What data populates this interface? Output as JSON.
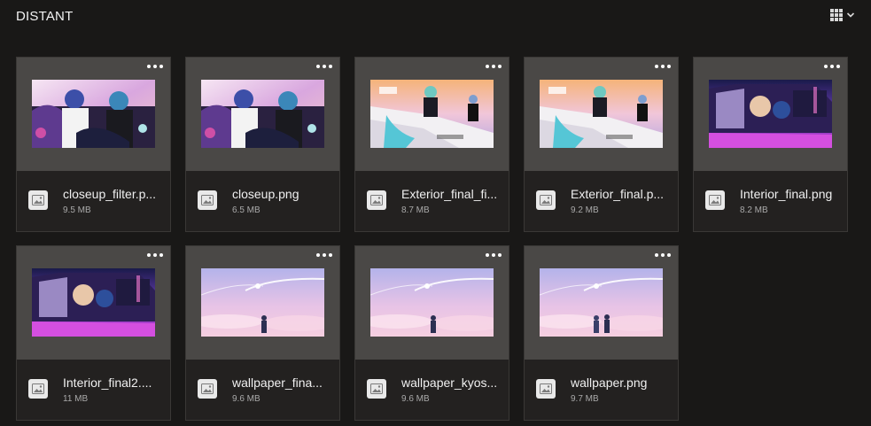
{
  "folder": {
    "title": "DISTANT",
    "view_icon": "grid-view-icon",
    "view_chevron": "chevron-down-icon"
  },
  "files": [
    {
      "name": "closeup_filter.p...",
      "size": "9.5 MB",
      "thumb": "car-closeup",
      "more_icon": "more-options-icon"
    },
    {
      "name": "closeup.png",
      "size": "6.5 MB",
      "thumb": "car-closeup",
      "more_icon": "more-options-icon"
    },
    {
      "name": "Exterior_final_fi...",
      "size": "8.7 MB",
      "thumb": "car-exterior",
      "more_icon": "more-options-icon"
    },
    {
      "name": "Exterior_final.p...",
      "size": "9.2 MB",
      "thumb": "car-exterior",
      "more_icon": "more-options-icon"
    },
    {
      "name": "Interior_final.png",
      "size": "8.2 MB",
      "thumb": "car-interior",
      "more_icon": "more-options-icon"
    },
    {
      "name": "Interior_final2....",
      "size": "11 MB",
      "thumb": "car-interior",
      "more_icon": "more-options-icon"
    },
    {
      "name": "wallpaper_fina...",
      "size": "9.6 MB",
      "thumb": "sky-single",
      "more_icon": "more-options-icon"
    },
    {
      "name": "wallpaper_kyos...",
      "size": "9.6 MB",
      "thumb": "sky-single",
      "more_icon": "more-options-icon"
    },
    {
      "name": "wallpaper.png",
      "size": "9.7 MB",
      "thumb": "sky-pair",
      "more_icon": "more-options-icon"
    }
  ]
}
